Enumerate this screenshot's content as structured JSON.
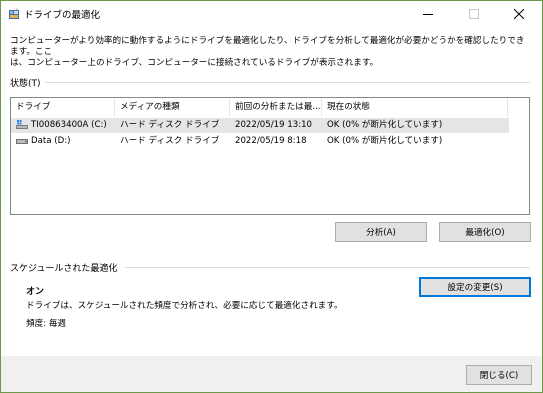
{
  "window": {
    "title": "ドライブの最適化"
  },
  "description": "コンピューターがより効率的に動作するようにドライブを最適化したり、ドライブを分析して最適化が必要かどうかを確認したりできます。ここ\nは、コンピューター上のドライブ、コンピューターに接続されているドライブが表示されます。",
  "status_section": {
    "label": "状態(T)"
  },
  "drive_list": {
    "columns": [
      "ドライブ",
      "メディアの種類",
      "前回の分析または最...",
      "現在の状態"
    ],
    "rows": [
      {
        "drive": "TI00863400A (C:)",
        "media_type": "ハード ディスク ドライブ",
        "last_analyzed": "2022/05/19 13:10",
        "status": "OK (0% が断片化しています)",
        "icon": "windows-drive-icon",
        "selected": true
      },
      {
        "drive": "Data (D:)",
        "media_type": "ハード ディスク ドライブ",
        "last_analyzed": "2022/05/19 8:18",
        "status": "OK (0% が断片化しています)",
        "icon": "hard-drive-icon",
        "selected": false
      }
    ]
  },
  "buttons": {
    "analyze": "分析(A)",
    "optimize": "最適化(O)",
    "change_settings": "設定の変更(S)",
    "close": "閉じる(C)"
  },
  "schedule_section": {
    "label": "スケジュールされた最適化",
    "status": "オン",
    "description": "ドライブは、スケジュールされた頻度で分析され、必要に応じて最適化されます。",
    "frequency": "頻度: 毎週"
  },
  "colors": {
    "window_border": "#6d9a4a",
    "selected_row": "#e5e5e5",
    "button_face": "#e1e1e1",
    "default_button_border": "#0078d7",
    "footer_bg": "#f0f0f0"
  }
}
